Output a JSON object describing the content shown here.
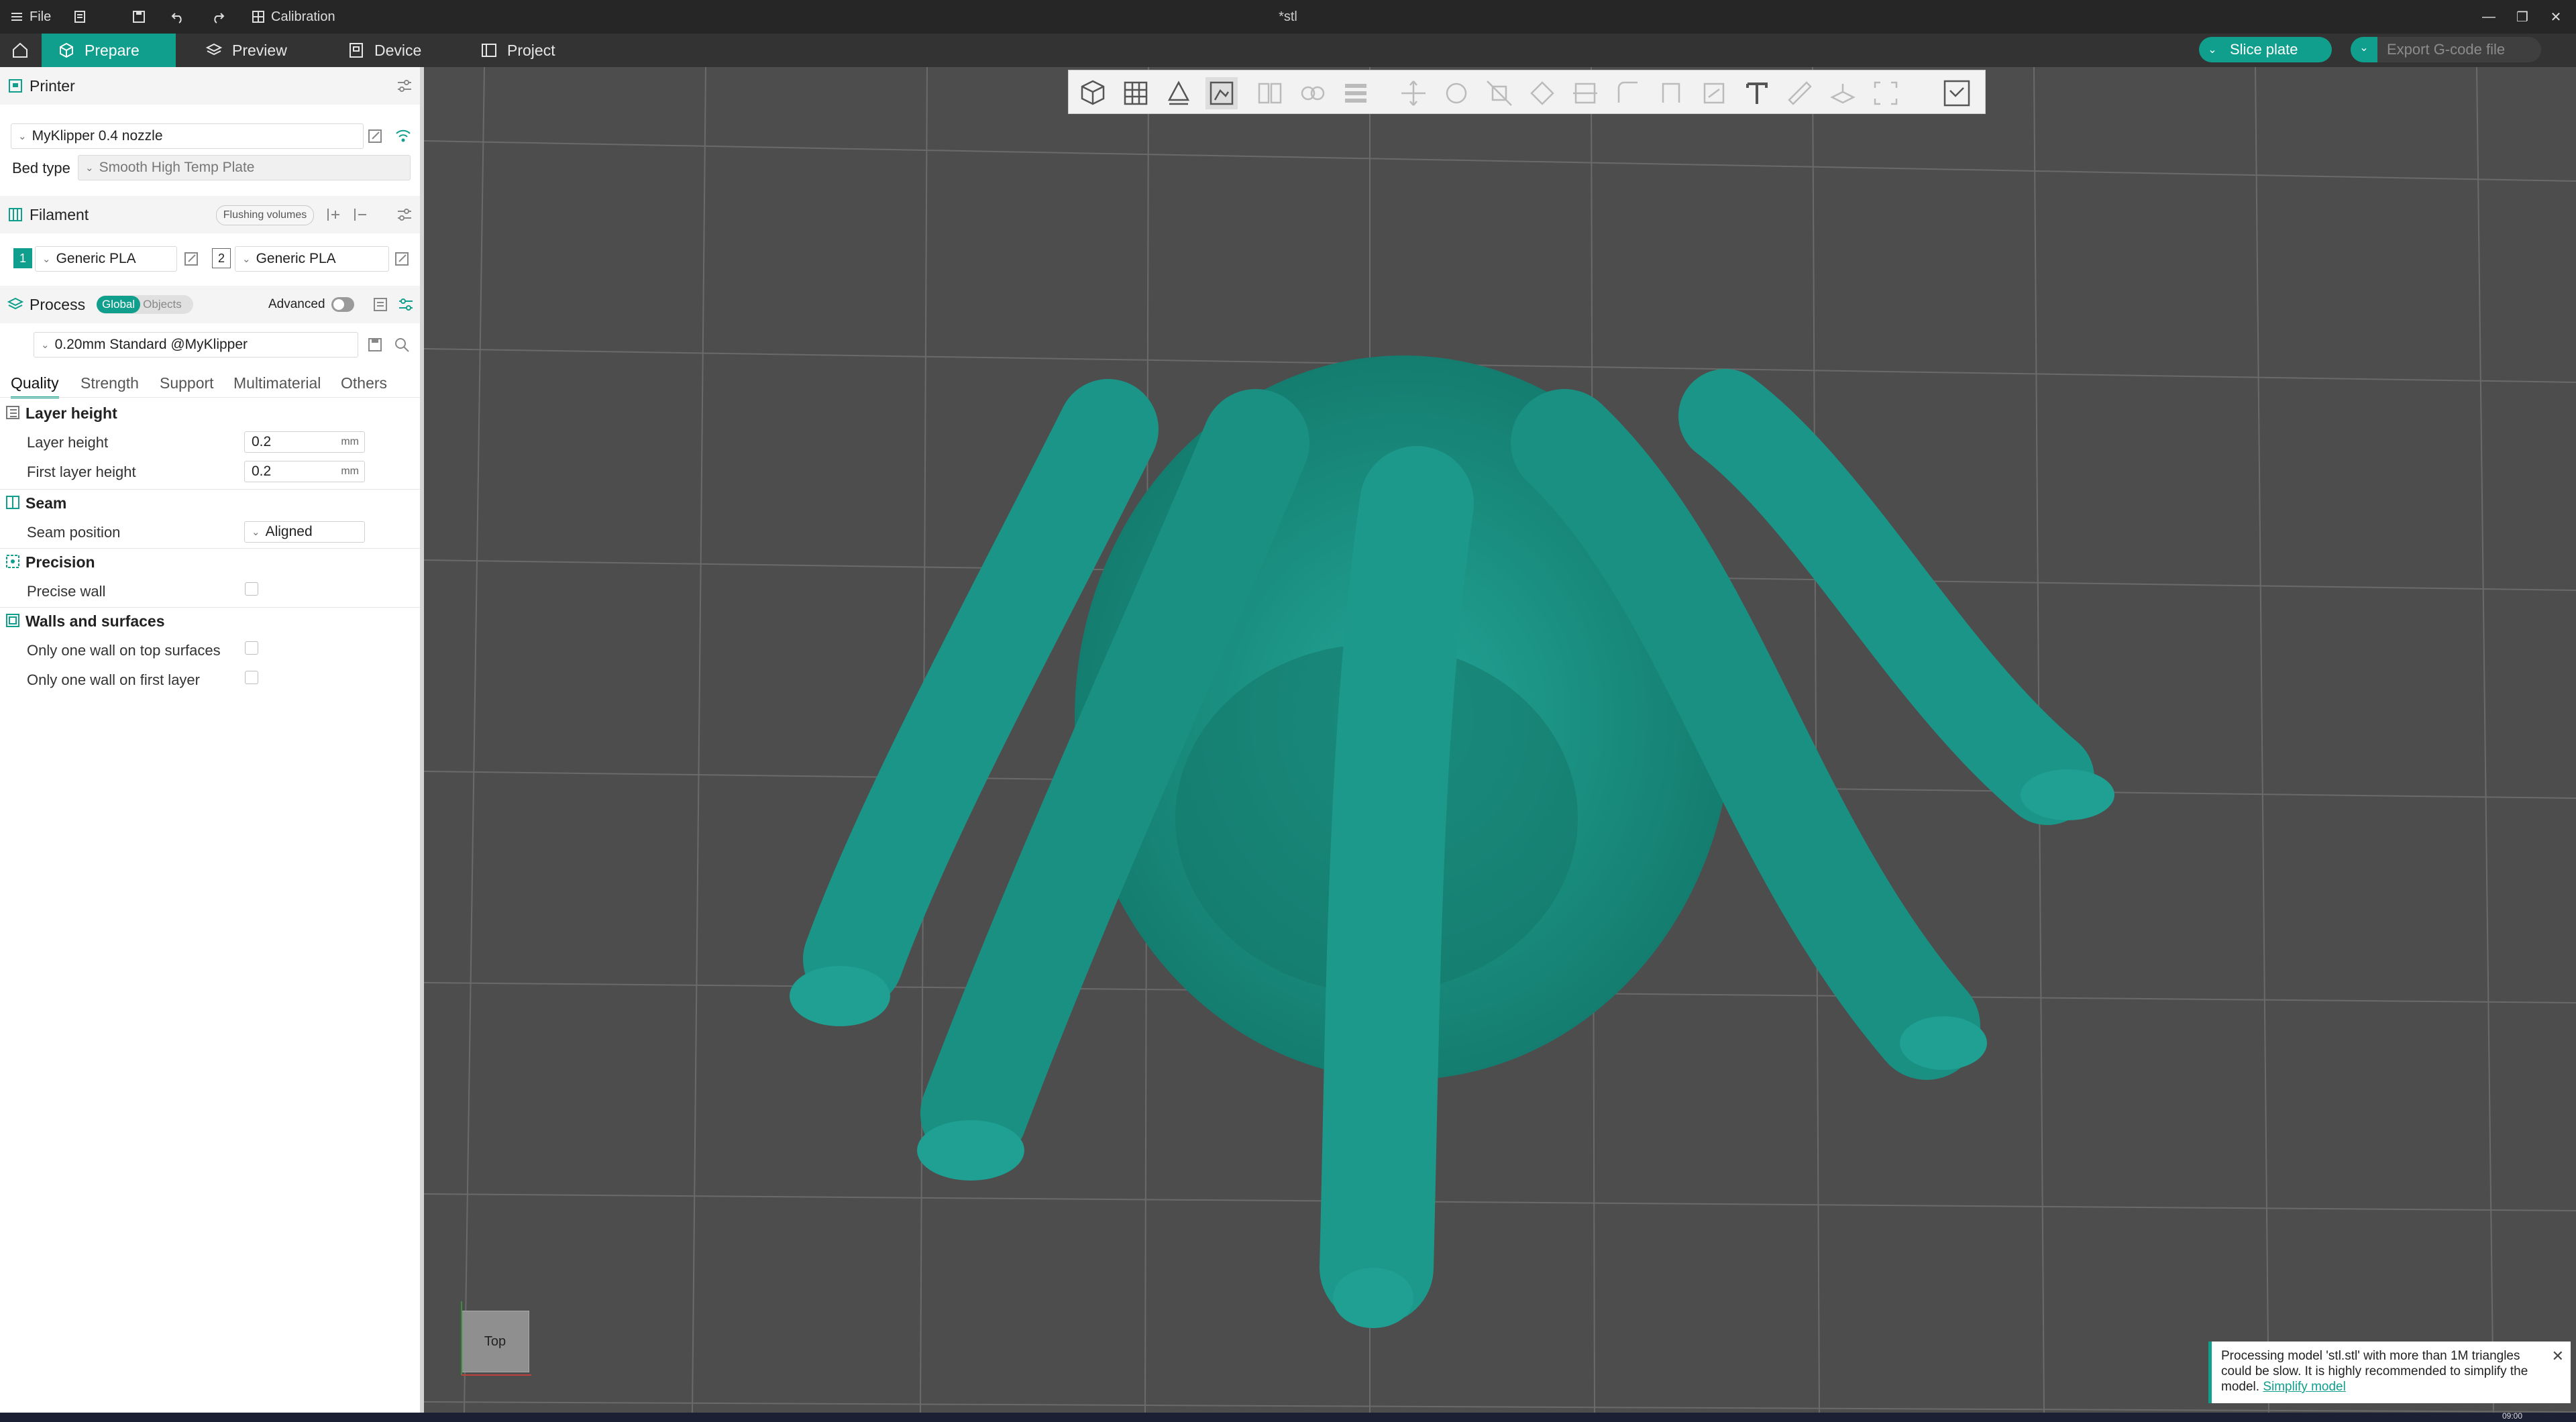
{
  "titlebar": {
    "file_label": "File",
    "calibration_label": "Calibration",
    "window_title": "*stl"
  },
  "nav": {
    "tabs": [
      {
        "label": "Prepare",
        "active": true
      },
      {
        "label": "Preview",
        "active": false
      },
      {
        "label": "Device",
        "active": false
      },
      {
        "label": "Project",
        "active": false
      }
    ],
    "slice_label": "Slice plate",
    "export_label": "Export G-code file"
  },
  "printer": {
    "section_title": "Printer",
    "name": "MyKlipper 0.4 nozzle",
    "bed_type_label": "Bed type",
    "bed_type_value": "Smooth High Temp Plate"
  },
  "filament": {
    "section_title": "Filament",
    "flushing_label": "Flushing volumes",
    "slots": [
      {
        "index": "1",
        "name": "Generic PLA",
        "color": "#0f9f8c"
      },
      {
        "index": "2",
        "name": "Generic PLA",
        "color": "#ffffff"
      }
    ]
  },
  "process": {
    "section_title": "Process",
    "global_label": "Global",
    "objects_label": "Objects",
    "advanced_label": "Advanced",
    "advanced_on": false,
    "preset": "0.20mm Standard @MyKlipper"
  },
  "tabs": {
    "items": [
      "Quality",
      "Strength",
      "Support",
      "Multimaterial",
      "Others"
    ],
    "active": "Quality"
  },
  "quality": {
    "layer_height_group": "Layer height",
    "layer_height_label": "Layer height",
    "layer_height_value": "0.2",
    "first_layer_label": "First layer height",
    "first_layer_value": "0.2",
    "unit": "mm",
    "seam_group": "Seam",
    "seam_position_label": "Seam position",
    "seam_position_value": "Aligned",
    "precision_group": "Precision",
    "precise_wall_label": "Precise wall",
    "walls_group": "Walls and surfaces",
    "one_wall_top_label": "Only one wall on top surfaces",
    "one_wall_first_label": "Only one wall on first layer"
  },
  "viewport": {
    "view_label": "Top",
    "model_color": "#1c9488",
    "notification": {
      "text": "Processing model 'stl.stl' with more than 1M triangles could be slow. It is highly recommended to simplify the model.",
      "link": "Simplify model"
    }
  },
  "taskbar": {
    "clock": "09:00"
  }
}
